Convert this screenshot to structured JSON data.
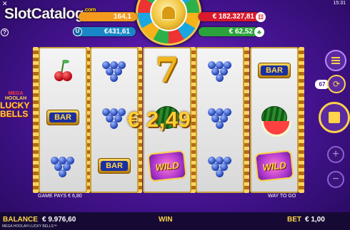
{
  "status": {
    "clock": "15:31",
    "close_glyph": "✕"
  },
  "watermark": {
    "text": "SlotCatalog",
    "suffix": ".com"
  },
  "help_label": "?",
  "jackpots": {
    "orange": "164,1",
    "blue": "€431,61",
    "red": "€ 182.327,81",
    "green": "€ 62,52"
  },
  "reels": [
    [
      "cherry",
      "bar",
      "grapes"
    ],
    [
      "grapes",
      "grapes",
      "bar"
    ],
    [
      "seven",
      "melon",
      "wild"
    ],
    [
      "grapes",
      "grapes",
      "grapes"
    ],
    [
      "bar",
      "melon",
      "wild"
    ]
  ],
  "symbol_text": {
    "bar": "BAR",
    "seven": "7",
    "wild": "WILD"
  },
  "win_amount": "€ 2,49",
  "game_pays": "GAME PAYS € 6,80",
  "way_to_go": "WAY TO GO",
  "side_logo": {
    "line1": "MEGA",
    "line2": "HOOLAH",
    "line3": "LUCKY",
    "line4": "BELLS"
  },
  "controls": {
    "autoplay_count": "67",
    "plus": "+",
    "minus": "−"
  },
  "bottom_bar": {
    "balance_label": "BALANCE",
    "balance_value": "€ 9.976,60",
    "win_label": "WIN",
    "bet_label": "BET",
    "bet_value": "€ 1,00",
    "game_title": "MEGA HOOLAH LUCKY BELLS™"
  }
}
